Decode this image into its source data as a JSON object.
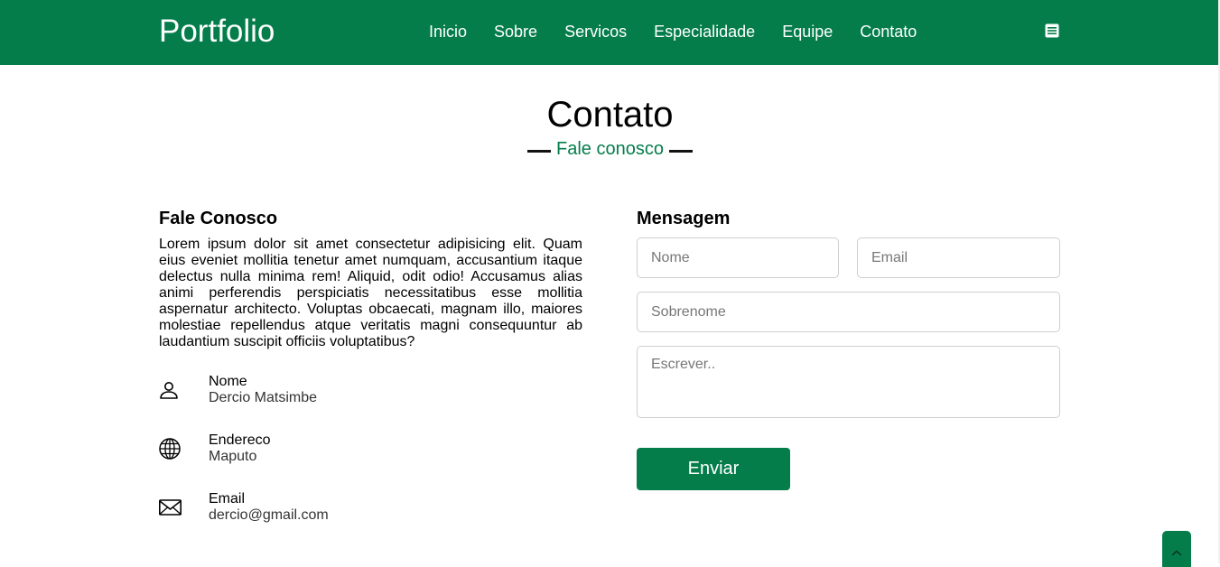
{
  "header": {
    "brand": "Portfolio",
    "nav": [
      {
        "label": "Inicio"
      },
      {
        "label": "Sobre"
      },
      {
        "label": "Servicos"
      },
      {
        "label": "Especialidade"
      },
      {
        "label": "Equipe"
      },
      {
        "label": "Contato"
      }
    ],
    "menu_icon": "list-icon"
  },
  "section": {
    "title": "Contato",
    "subtitle": "Fale conosco"
  },
  "contact_info": {
    "heading": "Fale Conosco",
    "text": "Lorem ipsum dolor sit amet consectetur adipisicing elit. Quam eius eveniet mollitia tenetur amet numquam, accusantium itaque delectus nulla minima rem! Aliquid, odit odio! Accusamus alias animi perferendis perspiciatis necessitatibus esse mollitia aspernatur architecto. Voluptas obcaecati, magnam illo, maiores molestiae repellendus atque veritatis magni consequuntur ab laudantium suscipit officiis voluptatibus?",
    "items": [
      {
        "icon": "person-icon",
        "label": "Nome",
        "value": "Dercio Matsimbe"
      },
      {
        "icon": "globe-icon",
        "label": "Endereco",
        "value": "Maputo"
      },
      {
        "icon": "envelope-icon",
        "label": "Email",
        "value": "dercio@gmail.com"
      }
    ]
  },
  "form": {
    "heading": "Mensagem",
    "name_placeholder": "Nome",
    "name_value": "",
    "email_placeholder": "Email",
    "email_value": "",
    "surname_placeholder": "Sobrenome",
    "surname_value": "",
    "message_placeholder": "Escrever..",
    "message_value": "",
    "submit_label": "Enviar"
  },
  "colors": {
    "primary": "#047d4b",
    "text": "#000000"
  },
  "back_to_top_icon": "chevron-up-icon"
}
